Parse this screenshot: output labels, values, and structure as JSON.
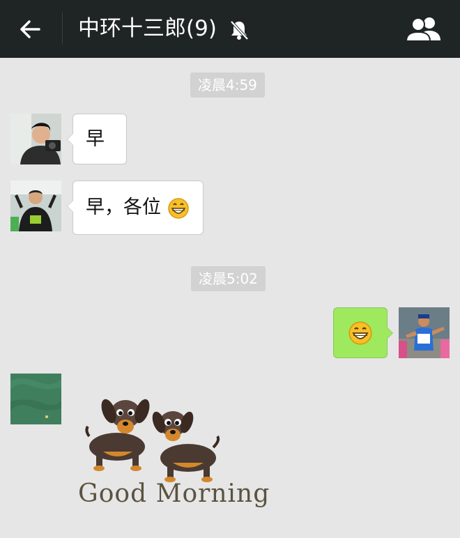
{
  "header": {
    "title": "中环十三郎(9)",
    "back_icon": "arrow-left-icon",
    "mute_icon": "bell-off-icon",
    "group_icon": "group-members-icon",
    "bg_color": "#1f2424"
  },
  "timestamps": [
    "凌晨4:59",
    "凌晨5:02"
  ],
  "messages": [
    {
      "side": "left",
      "text": "早",
      "emoji": ""
    },
    {
      "side": "left",
      "text": "早，各位",
      "emoji": "grinning-face"
    },
    {
      "side": "right",
      "text": "",
      "emoji": "grinning-face"
    },
    {
      "side": "left",
      "sticker": "Good Morning"
    }
  ],
  "colors": {
    "chat_bg": "#e6e6e6",
    "own_bubble": "#9ee95e",
    "other_bubble": "#ffffff",
    "timestamp_bg": "#d2d2d2"
  }
}
